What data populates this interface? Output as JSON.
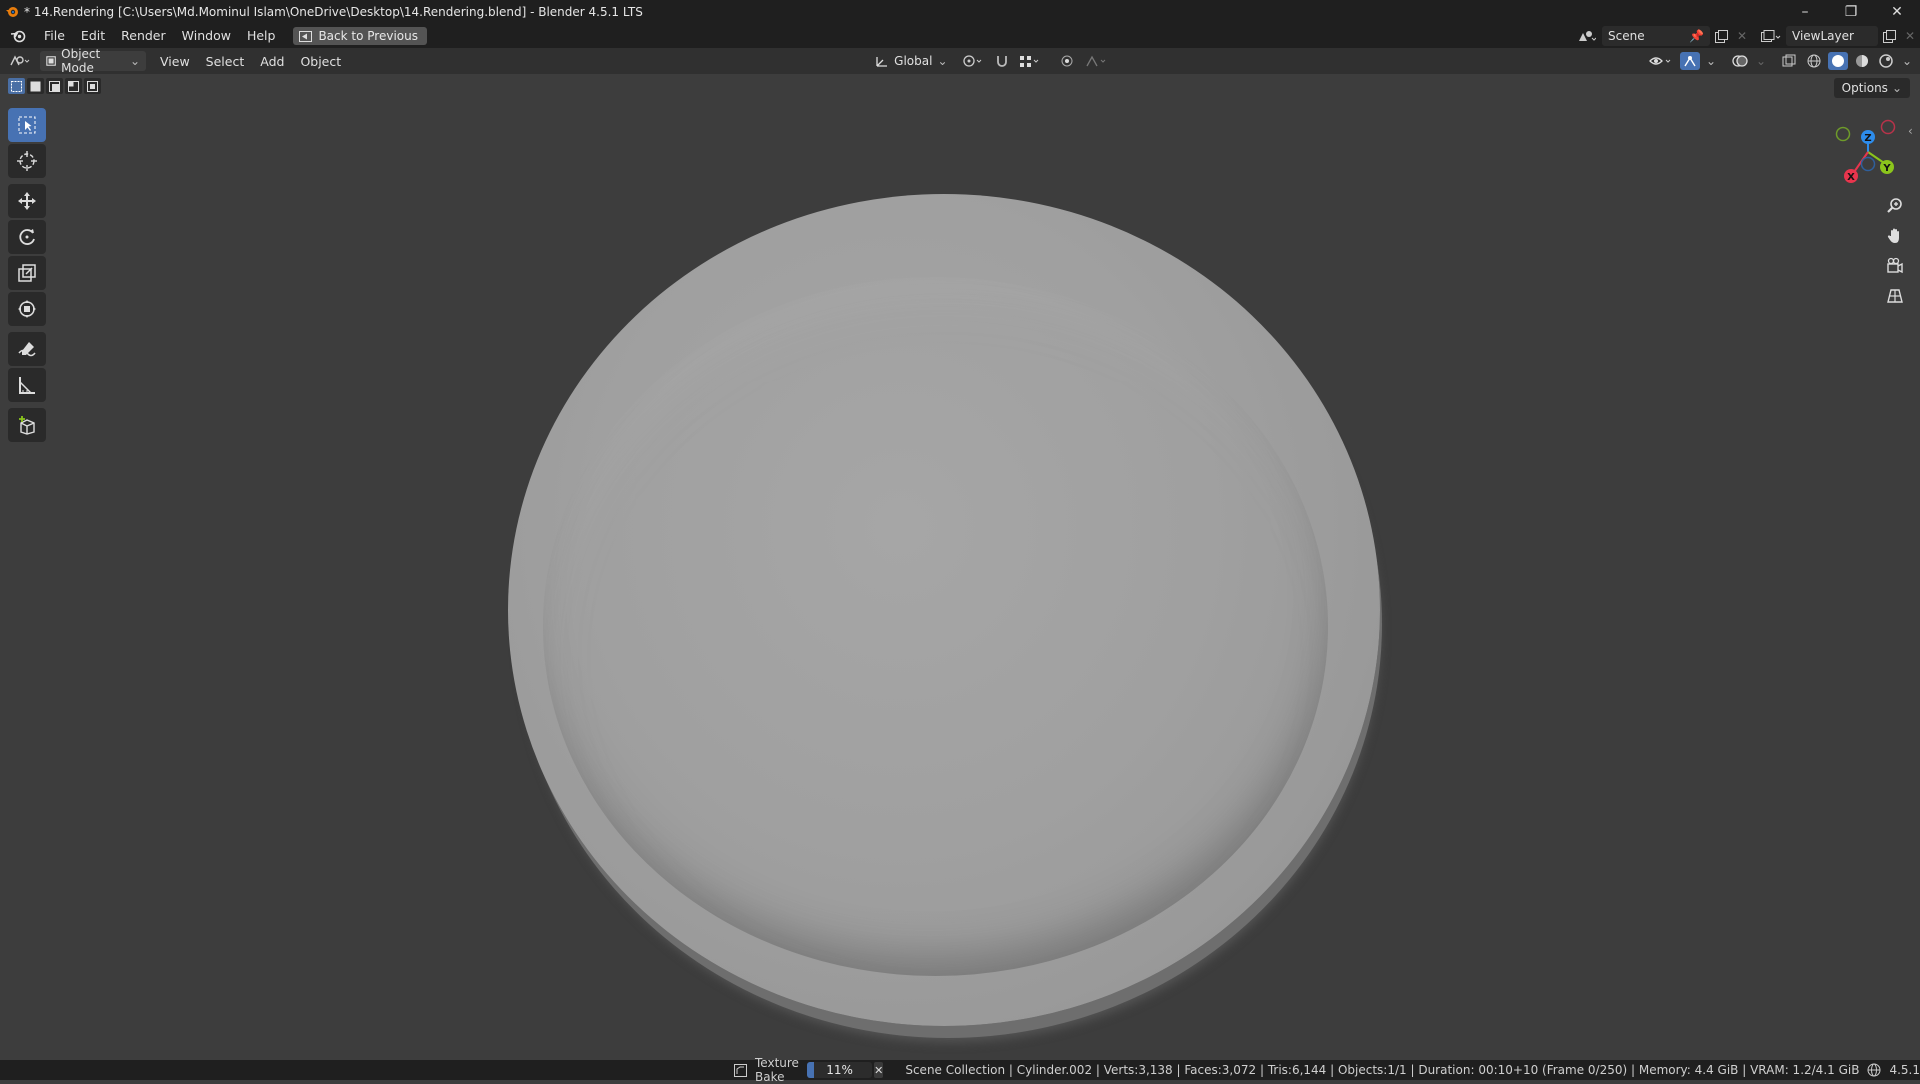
{
  "window": {
    "title": "* 14.Rendering [C:\\Users\\Md.Mominul Islam\\OneDrive\\Desktop\\14.Rendering.blend] - Blender 4.5.1 LTS"
  },
  "menubar": {
    "items": [
      "File",
      "Edit",
      "Render",
      "Window",
      "Help"
    ],
    "back_button": "Back to Previous",
    "scene": "Scene",
    "view_layer": "ViewLayer"
  },
  "header3d": {
    "mode": "Object Mode",
    "menus": [
      "View",
      "Select",
      "Add",
      "Object"
    ],
    "transform_orientation": "Global"
  },
  "viewport": {
    "options_label": "Options",
    "gizmo": {
      "x": "X",
      "y": "Y",
      "z": "Z",
      "x_color": "#e8354d",
      "y_color": "#8bc51c",
      "z_color": "#2d8ceb"
    }
  },
  "statusbar": {
    "job_label": "Texture Bake",
    "progress_text": "11%",
    "progress_value": 0.11,
    "info": "Scene Collection | Cylinder.002 | Verts:3,138 | Faces:3,072 | Tris:6,144 | Objects:1/1 | Duration: 00:10+10 (Frame 0/250) | Memory: 4.4 GiB | VRAM: 1.2/4.1 GiB",
    "version": "4.5.1"
  },
  "icons": [
    "blender-icon",
    "editor-type-icon",
    "object-mode-icon",
    "select-box-icon",
    "cursor-icon",
    "move-icon",
    "rotate-icon",
    "scale-icon",
    "transform-icon",
    "annotate-icon",
    "measure-icon",
    "add-cube-icon",
    "zoom-icon",
    "pan-icon",
    "camera-icon",
    "grid-icon"
  ]
}
